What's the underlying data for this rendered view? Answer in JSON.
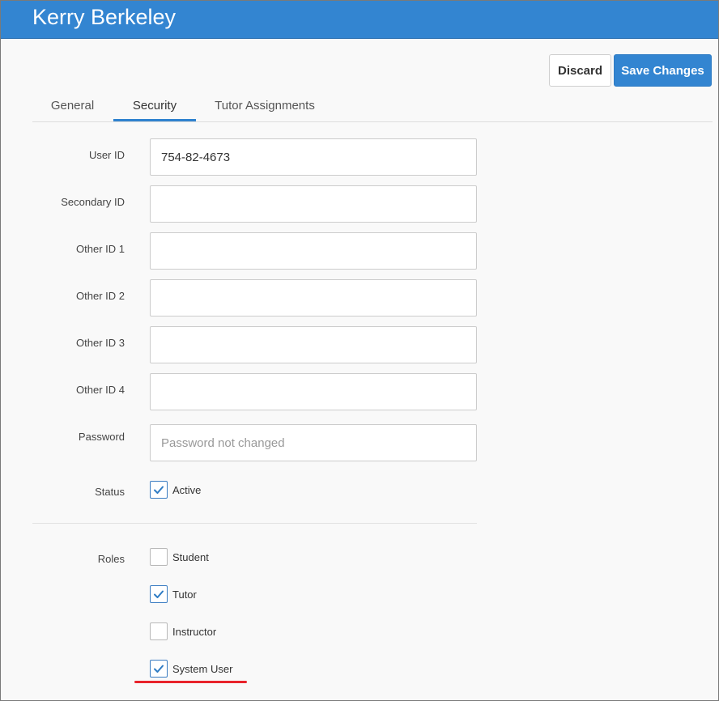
{
  "header": {
    "title": "Kerry Berkeley"
  },
  "toolbar": {
    "discard_label": "Discard",
    "save_label": "Save Changes"
  },
  "tabs": [
    {
      "label": "General",
      "active": false
    },
    {
      "label": "Security",
      "active": true
    },
    {
      "label": "Tutor Assignments",
      "active": false
    }
  ],
  "fields": {
    "user_id": {
      "label": "User ID",
      "value": "754-82-4673"
    },
    "secondary_id": {
      "label": "Secondary ID",
      "value": ""
    },
    "other_id_1": {
      "label": "Other ID 1",
      "value": ""
    },
    "other_id_2": {
      "label": "Other ID 2",
      "value": ""
    },
    "other_id_3": {
      "label": "Other ID 3",
      "value": ""
    },
    "other_id_4": {
      "label": "Other ID 4",
      "value": ""
    },
    "password": {
      "label": "Password",
      "placeholder": "Password not changed"
    }
  },
  "status": {
    "label": "Status",
    "option": "Active",
    "checked": true
  },
  "roles": {
    "label": "Roles",
    "items": [
      {
        "label": "Student",
        "checked": false
      },
      {
        "label": "Tutor",
        "checked": true
      },
      {
        "label": "Instructor",
        "checked": false
      },
      {
        "label": "System User",
        "checked": true
      }
    ]
  },
  "colors": {
    "header_bg": "#3385d1",
    "primary_button": "#3385d1",
    "active_tab": "#2f82cf",
    "annotation_underline": "#e8232b"
  }
}
